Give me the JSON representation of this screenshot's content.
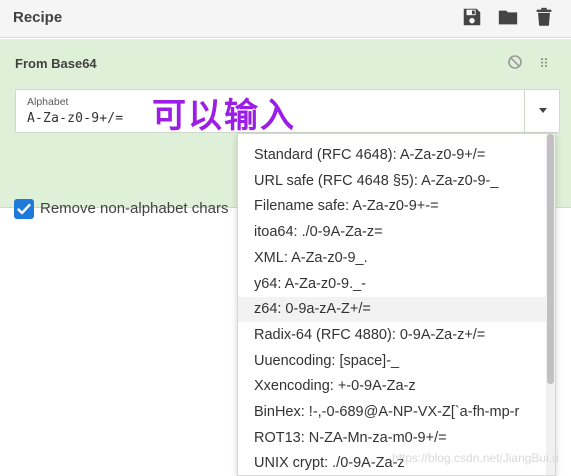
{
  "recipe": {
    "title": "Recipe",
    "icons": [
      "save-icon",
      "folder-icon",
      "trash-icon"
    ]
  },
  "operation": {
    "title": "From Base64",
    "icons": [
      "disable-icon",
      "drag-handle-icon"
    ],
    "alphabet": {
      "label": "Alphabet",
      "value": "A-Za-z0-9+/="
    },
    "overlay_text": "可以输入",
    "remove_non_alphabet": {
      "label": "Remove non-alphabet chars",
      "checked": true
    }
  },
  "dropdown": {
    "items": [
      "Standard (RFC 4648): A-Za-z0-9+/=",
      "URL safe (RFC 4648 §5): A-Za-z0-9-_",
      "Filename safe: A-Za-z0-9+-=",
      "itoa64: ./0-9A-Za-z=",
      "XML: A-Za-z0-9_.",
      "y64: A-Za-z0-9._-",
      "z64: 0-9a-zA-Z+/=",
      "Radix-64 (RFC 4880): 0-9A-Za-z+/=",
      "Uuencoding: [space]-_",
      "Xxencoding: +-0-9A-Za-z",
      "BinHex: !-,-0-689@A-NP-VX-Z[`a-fh-mp-r",
      "ROT13: N-ZA-Mn-za-m0-9+/=",
      "UNIX crypt: ./0-9A-Za-z"
    ],
    "hovered_index": 6
  },
  "watermark": "https://blog.csdn.net/JiangBui.u",
  "colors": {
    "accent": "#1e7ad9",
    "operation_bg": "#dff0d8",
    "overlay_text": "#9c1ee6"
  }
}
